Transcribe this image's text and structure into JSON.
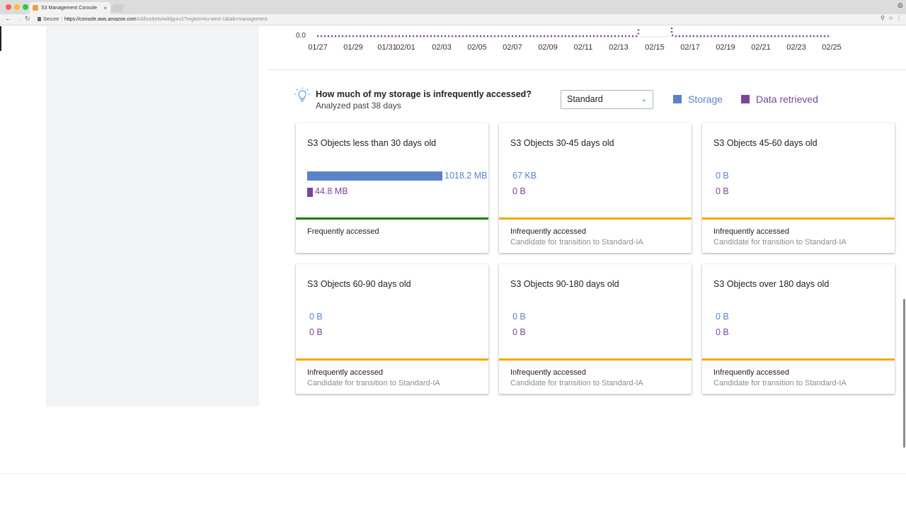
{
  "browser": {
    "tab_title": "S3 Management Console",
    "tab_close": "×",
    "secure_label": "Secure",
    "url_host": "https://console.aws.amazon.com",
    "url_path": "/s3/buckets/wildguru1?region=eu-west-1&tab=management"
  },
  "chart": {
    "ytick": "0.0",
    "xticks": [
      "01/27",
      "01/29",
      "01/31",
      "02/01",
      "02/03",
      "02/05",
      "02/07",
      "02/09",
      "02/11",
      "02/13",
      "02/15",
      "02/17",
      "02/19",
      "02/21",
      "02/23",
      "02/25"
    ],
    "line_color": "#7d4499"
  },
  "analysis": {
    "title": "How much of my storage is infrequently accessed?",
    "subtitle": "Analyzed past 38 days",
    "storage_class": "Standard",
    "legend": [
      {
        "label": "Storage",
        "color": "#5a82c8"
      },
      {
        "label": "Data retrieved",
        "color": "#7d4499"
      }
    ]
  },
  "colors": {
    "frequent": "#1d8102",
    "infrequent": "#f2a900"
  },
  "cards": [
    {
      "title": "S3 Objects less than 30 days old",
      "storage": "1018.2 MB",
      "retrieved": "44.8 MB",
      "storage_fraction": 1.0,
      "retrieved_fraction": 0.044,
      "status": "Frequently accessed",
      "note": ""
    },
    {
      "title": "S3 Objects 30-45 days old",
      "storage": "67 KB",
      "retrieved": "0 B",
      "storage_fraction": 0.0001,
      "retrieved_fraction": 0,
      "status": "Infrequently accessed",
      "note": "Candidate for transition to Standard-IA"
    },
    {
      "title": "S3 Objects 45-60 days old",
      "storage": "0 B",
      "retrieved": "0 B",
      "storage_fraction": 0,
      "retrieved_fraction": 0,
      "status": "Infrequently accessed",
      "note": "Candidate for transition to Standard-IA"
    },
    {
      "title": "S3 Objects 60-90 days old",
      "storage": "0 B",
      "retrieved": "0 B",
      "storage_fraction": 0,
      "retrieved_fraction": 0,
      "status": "Infrequently accessed",
      "note": "Candidate for transition to Standard-IA"
    },
    {
      "title": "S3 Objects 90-180 days old",
      "storage": "0 B",
      "retrieved": "0 B",
      "storage_fraction": 0,
      "retrieved_fraction": 0,
      "status": "Infrequently accessed",
      "note": "Candidate for transition to Standard-IA"
    },
    {
      "title": "S3 Objects over 180 days old",
      "storage": "0 B",
      "retrieved": "0 B",
      "storage_fraction": 0,
      "retrieved_fraction": 0,
      "status": "Infrequently accessed",
      "note": "Candidate for transition to Standard-IA"
    }
  ]
}
